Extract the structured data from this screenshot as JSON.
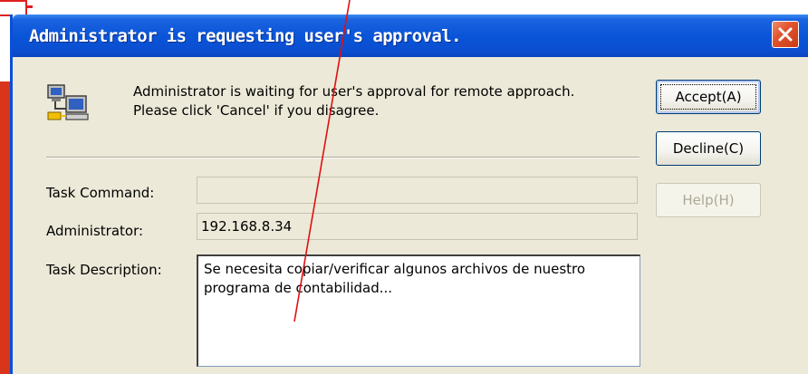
{
  "dialog": {
    "title": "Administrator is requesting user's approval.",
    "message": "Administrator is waiting for user's approval for remote approach. Please click 'Cancel' if you disagree.",
    "buttons": {
      "accept": "Accept(A)",
      "decline": "Decline(C)",
      "help": "Help(H)"
    },
    "fields": {
      "task_command_label": "Task Command:",
      "task_command_value": "",
      "administrator_label": "Administrator:",
      "administrator_value": "192.168.8.34",
      "task_description_label": "Task Description:",
      "task_description_value": "Se necesita copiar/verificar algunos archivos de nuestro programa de contabilidad..."
    }
  },
  "icons": {
    "window": "computer-network-icon",
    "close": "close-icon"
  },
  "colors": {
    "titlebar": "#0a55d8",
    "dialog_bg": "#ece9d8",
    "close_button": "#e0552d",
    "annotation": "#e01010"
  }
}
